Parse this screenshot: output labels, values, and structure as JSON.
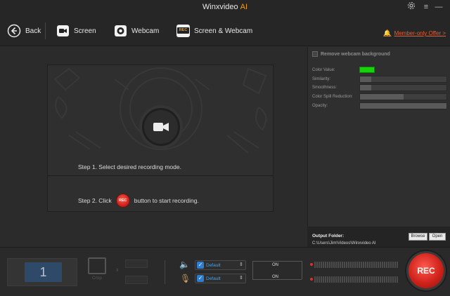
{
  "window": {
    "title": "Winxvideo",
    "title_suffix": "AI"
  },
  "toolbar": {
    "back_label": "Back",
    "screen_label": "Screen",
    "webcam_label": "Webcam",
    "screen_webcam_label": "Screen & Webcam",
    "screen_webcam_icon_text": "REC",
    "offer_label": "Member-only Offer >"
  },
  "main": {
    "step1": "Step 1. Select desired recording mode.",
    "step2_prefix": "Step 2. Click",
    "step2_suffix": "button to start recording.",
    "rec_small_label": "REC"
  },
  "webcam_settings": {
    "remove_bg_label": "Remove webcam background",
    "remove_bg_checked": false,
    "color_value_label": "Color Value:",
    "color_value": "#17d40a",
    "similarity_label": "Similarity:",
    "similarity": 0.13,
    "smoothness_label": "Smoothness:",
    "smoothness": 0.13,
    "spill_label": "Color Spill Reduction:",
    "spill": 0.5,
    "opacity_label": "Opacity:",
    "opacity": 1.0
  },
  "output": {
    "label": "Output Folder:",
    "path": "C:\\Users\\Jim\\Videos\\Winxvideo AI",
    "browse_label": "Browse",
    "open_label": "Open"
  },
  "bottom": {
    "screen_number": "1",
    "crop_label": "Crop",
    "audio": {
      "speaker_device": "Default",
      "speaker_checked": true,
      "mic_device": "Default",
      "mic_checked": true,
      "speaker_state": "ON",
      "mic_state": "ON"
    },
    "rec_label": "REC"
  }
}
